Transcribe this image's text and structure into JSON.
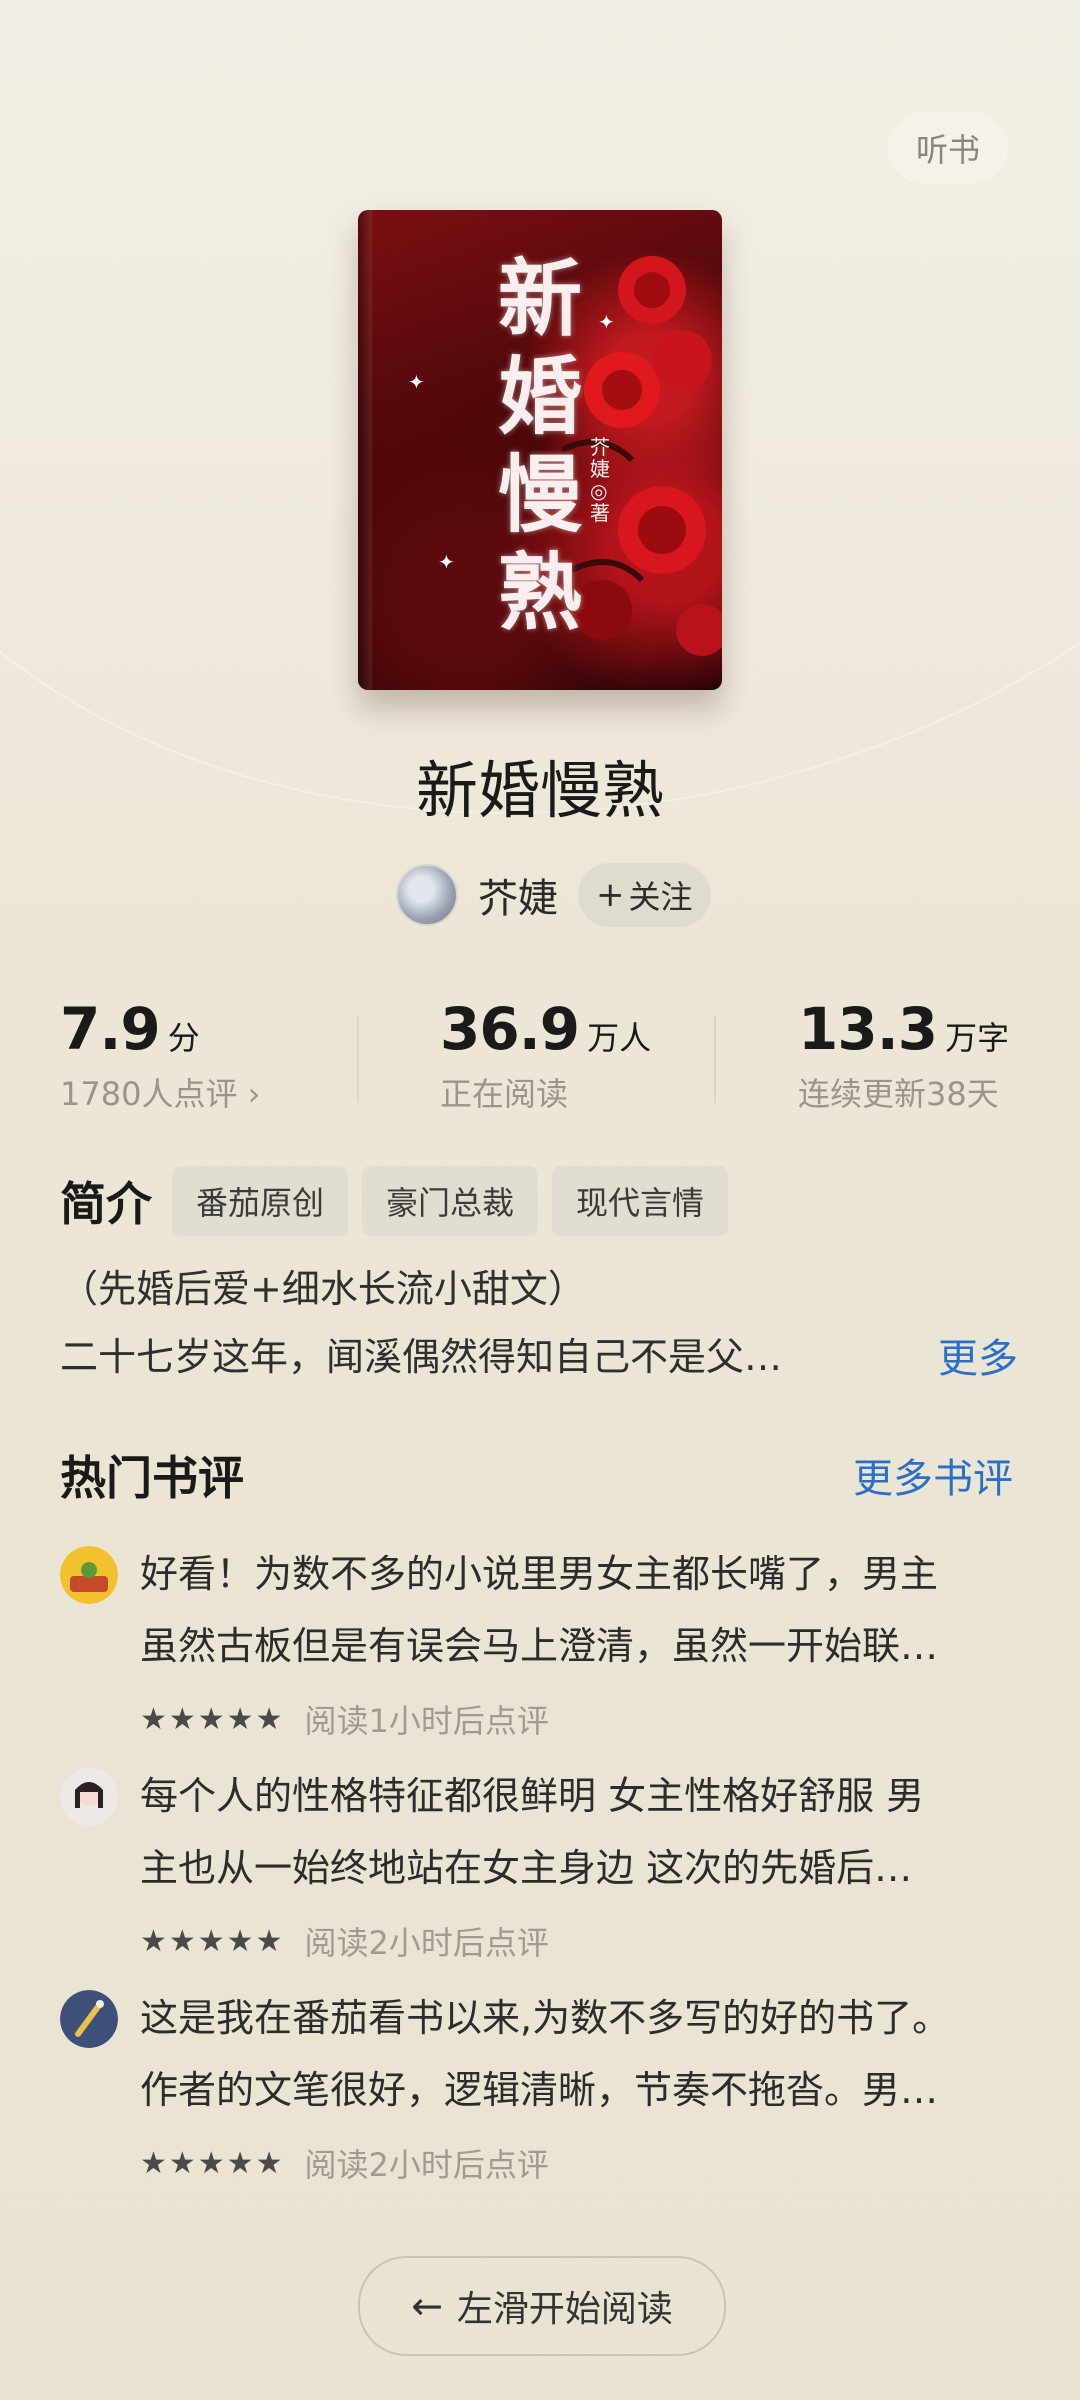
{
  "header": {
    "listen_label": "听书"
  },
  "cover": {
    "title_lines": [
      "新",
      "婚",
      "慢",
      "熟"
    ],
    "author_mark": "芥婕◎著"
  },
  "book": {
    "title": "新婚慢熟",
    "author": "芥婕",
    "follow_label": "关注"
  },
  "stats": {
    "rating": {
      "value": "7.9",
      "unit": "分",
      "sub": "1780人点评 ›"
    },
    "readers": {
      "value": "36.9",
      "unit": "万人",
      "sub": "正在阅读"
    },
    "words": {
      "value": "13.3",
      "unit": "万字",
      "sub": "连续更新38天"
    }
  },
  "intro": {
    "label": "简介",
    "tags": [
      "番茄原创",
      "豪门总裁",
      "现代言情"
    ],
    "line1": "（先婚后爱+细水长流小甜文）",
    "line2": "二十七岁这年，闻溪偶然得知自己不是父…",
    "more_label": "更多"
  },
  "reviews": {
    "title": "热门书评",
    "more_label": "更多书评",
    "items": [
      {
        "line1": "好看！为数不多的小说里男女主都长嘴了，男主",
        "line2": "虽然古板但是有误会马上澄清，虽然一开始联…",
        "stars": "★★★★★",
        "read_time": "阅读1小时后点评"
      },
      {
        "line1": "每个人的性格特征都很鲜明 女主性格好舒服 男",
        "line2": "主也从一始终地站在女主身边 这次的先婚后…",
        "stars": "★★★★★",
        "read_time": "阅读2小时后点评"
      },
      {
        "line1": "这是我在番茄看书以来,为数不多写的好的书了。",
        "line2": "作者的文笔很好，逻辑清晰，节奏不拖沓。男…",
        "stars": "★★★★★",
        "read_time": "阅读2小时后点评"
      }
    ]
  },
  "footer": {
    "start_label": "左滑开始阅读"
  },
  "colors": {
    "accent_blue": "#2a6fc8",
    "background": "#ece6d6"
  }
}
